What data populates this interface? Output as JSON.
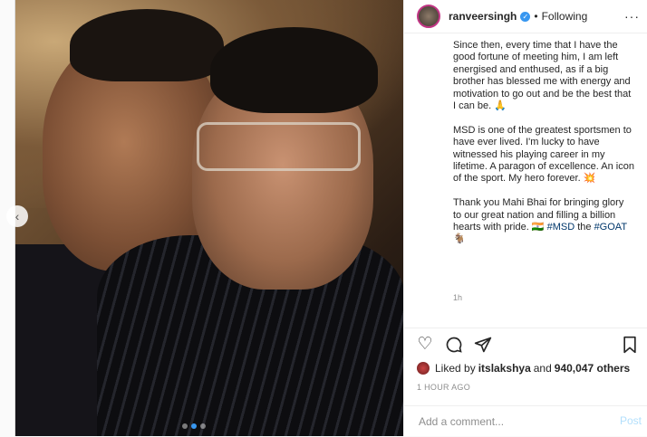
{
  "header": {
    "username": "ranveersingh",
    "separator": "•",
    "follow_status": "Following",
    "more": "···"
  },
  "caption": {
    "paragraphs": [
      "Since then, every time that I have the good fortune of meeting him, I am left energised and enthused, as if a big brother has blessed me with energy and motivation to go out and be the best that I can be. 🙏",
      "MSD is one of the greatest sportsmen to have ever lived. I'm lucky to have witnessed his playing career in my lifetime. A paragon of excellence. An icon of the sport. My hero forever. 💥",
      "Thank you Mahi Bhai for bringing glory to our great nation and filling a billion hearts with pride. 🇮🇳"
    ],
    "hashtag_msd": "#MSD",
    "word_the": "the",
    "hashtag_goat": "#GOAT",
    "goat_emoji": "🐐",
    "timestamp": "1h"
  },
  "carousel": {
    "slide_count": 3,
    "current_slide": 2,
    "prev_glyph": "‹"
  },
  "actions": {
    "like_icon": "heart-icon",
    "comment_icon": "comment-icon",
    "share_icon": "share-icon",
    "save_icon": "bookmark-icon"
  },
  "likes": {
    "text_prefix": "Liked by ",
    "user": "itslakshya",
    "text_middle": " and ",
    "count": "940,047 others"
  },
  "time_ago": "1 HOUR AGO",
  "comment_box": {
    "placeholder": "Add a comment...",
    "post_label": "Post"
  },
  "colors": {
    "link": "#00376b",
    "accent": "#3897f0",
    "muted": "#8e8e8e"
  }
}
